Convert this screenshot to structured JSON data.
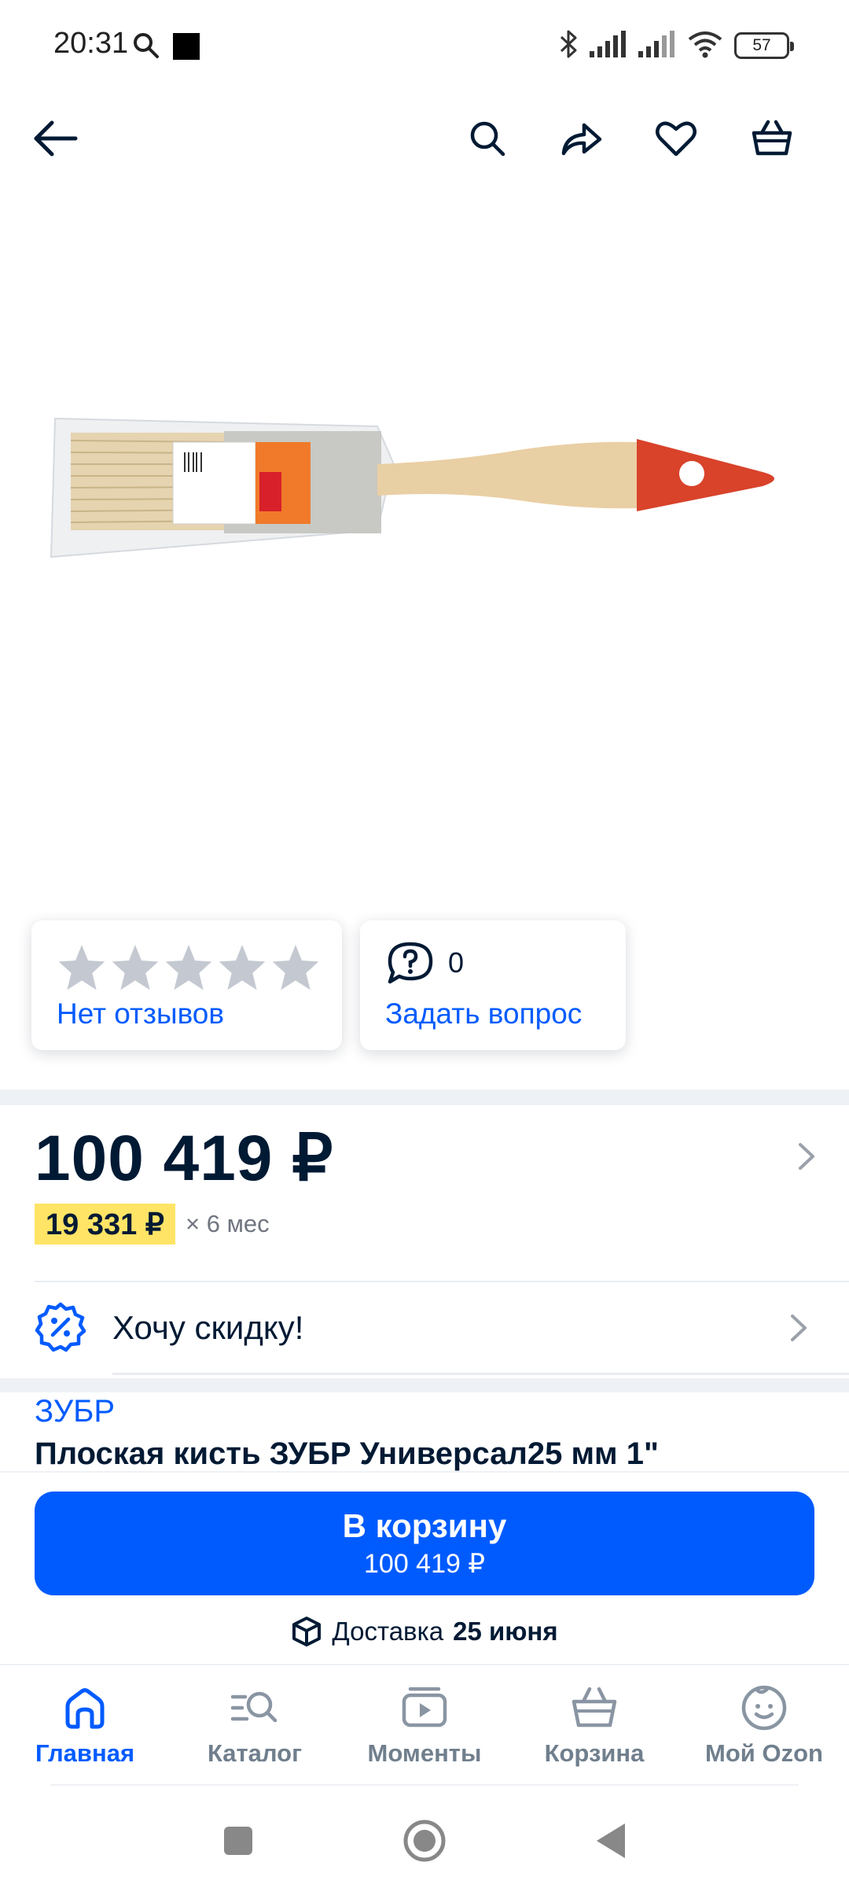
{
  "status_bar": {
    "time": "20:31",
    "battery": "57"
  },
  "rating": {
    "stars_filled": 0,
    "stars_total": 5,
    "reviews_label": "Нет отзывов"
  },
  "questions": {
    "count": "0",
    "ask_label": "Задать вопрос"
  },
  "price": {
    "main": "100 419 ₽",
    "installment_amount": "19 331 ₽",
    "installment_term": "× 6 мес"
  },
  "discount": {
    "label": "Хочу скидку!"
  },
  "product": {
    "brand": "ЗУБР",
    "title": "Плоская кисть ЗУБР Универсал25 мм 1\""
  },
  "cart_button": {
    "label": "В корзину",
    "price": "100 419 ₽"
  },
  "delivery": {
    "prefix": "Доставка",
    "date": "25 июня"
  },
  "bottom_nav": {
    "items": [
      {
        "label": "Главная",
        "icon": "home-icon",
        "active": true
      },
      {
        "label": "Каталог",
        "icon": "catalog-icon",
        "active": false
      },
      {
        "label": "Моменты",
        "icon": "moments-icon",
        "active": false
      },
      {
        "label": "Корзина",
        "icon": "basket-icon",
        "active": false
      },
      {
        "label": "Мой Ozon",
        "icon": "profile-icon",
        "active": false
      }
    ]
  },
  "colors": {
    "accent": "#005bff",
    "text": "#001a34",
    "installment_highlight": "#ffe466",
    "star_empty": "#c4c9d1"
  }
}
